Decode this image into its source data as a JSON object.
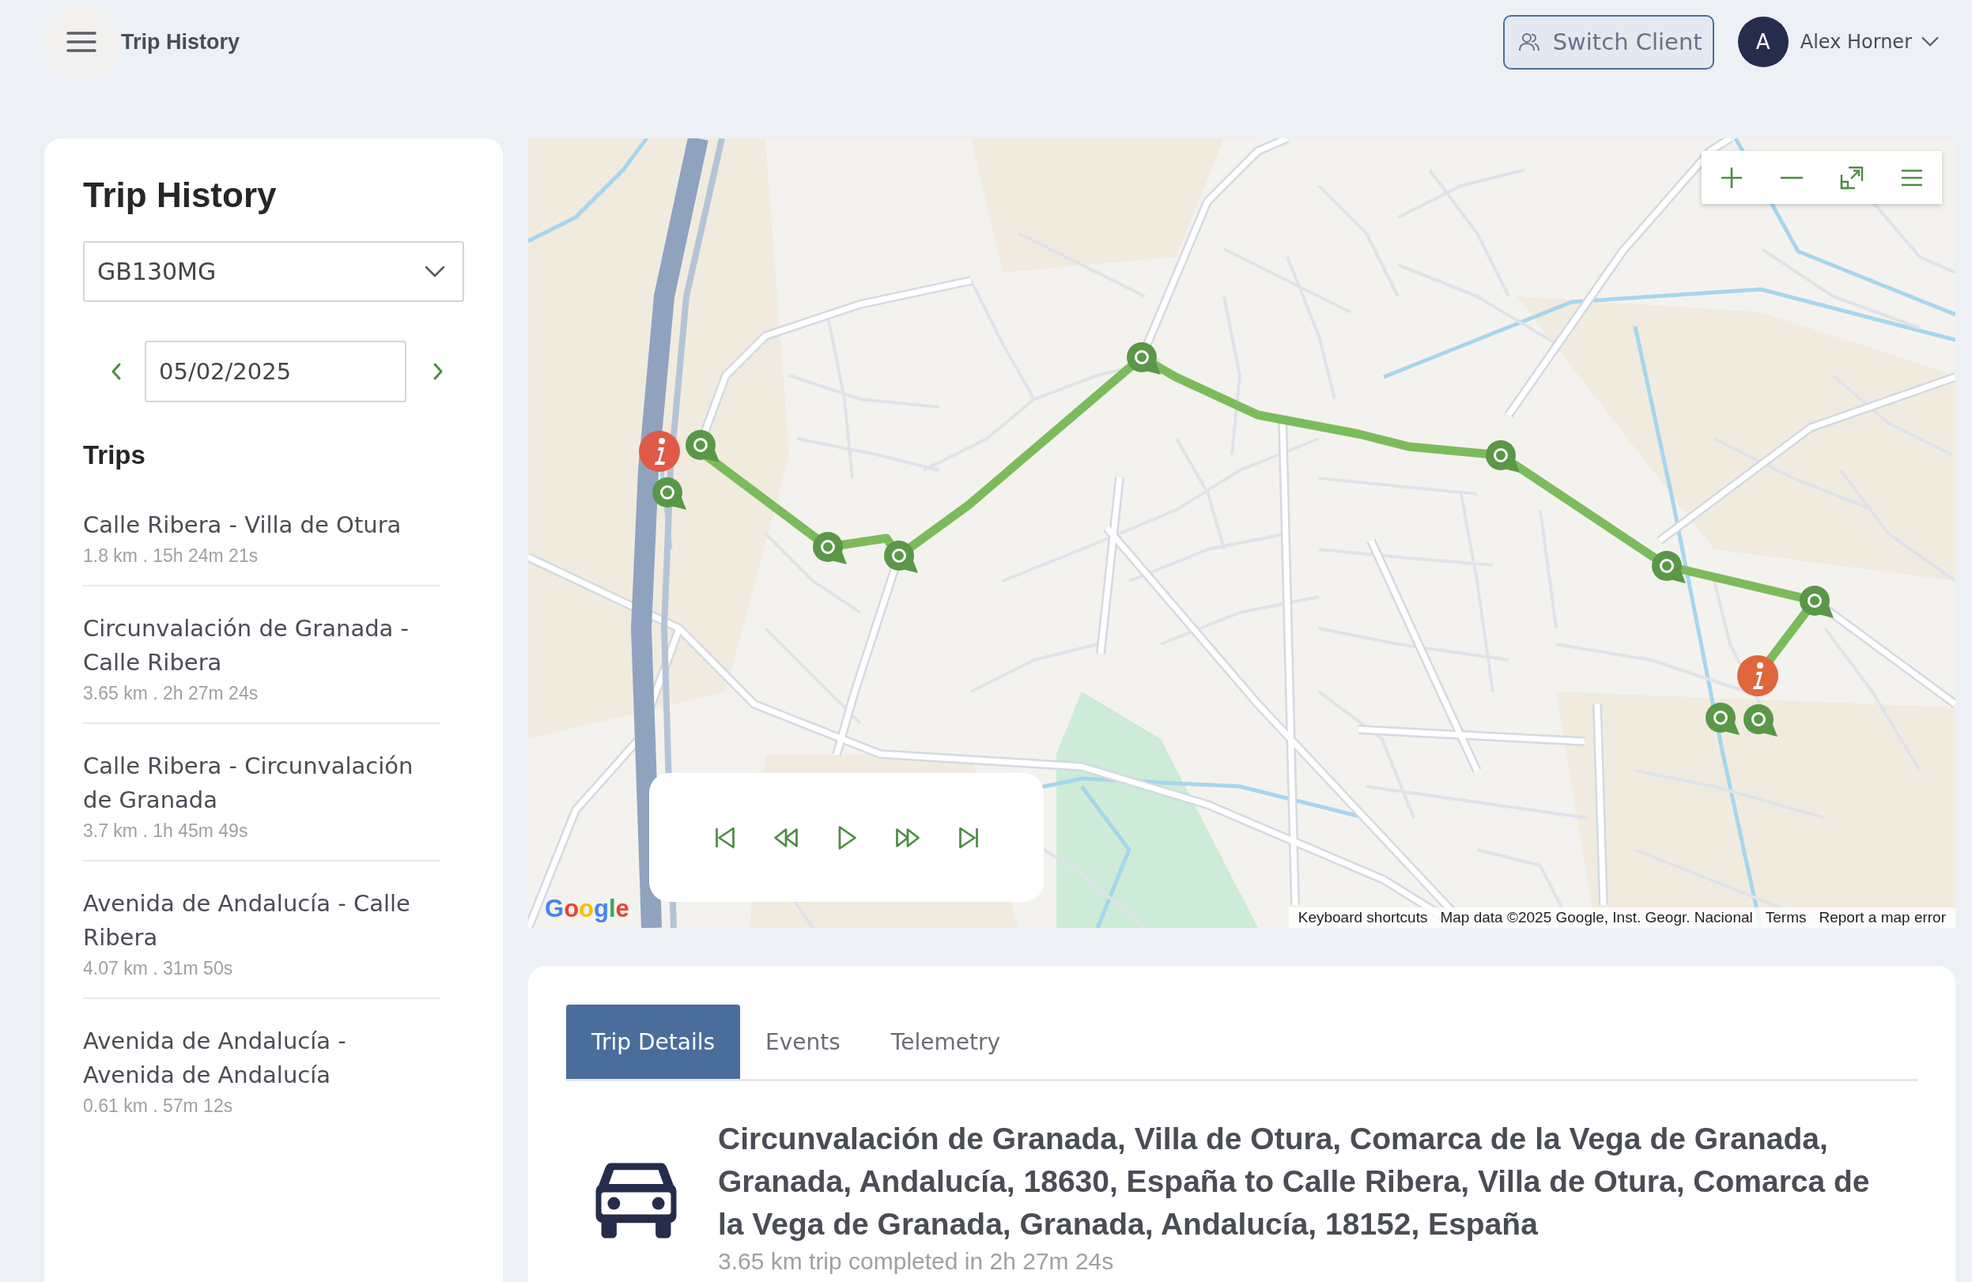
{
  "header": {
    "title": "Trip History",
    "switch_client": "Switch Client",
    "user": {
      "initial": "A",
      "name": "Alex Horner"
    }
  },
  "sidebar": {
    "title": "Trip History",
    "vehicle_select": {
      "value": "GB130MG"
    },
    "date_field": {
      "value": "05/02/2025"
    },
    "trips_heading": "Trips",
    "trips": [
      {
        "title": "Calle Ribera - Villa de Otura",
        "meta": "1.8 km . 15h 24m 21s"
      },
      {
        "title": "Circunvalación de Granada - Calle Ribera",
        "meta": "3.65 km . 2h 27m 24s"
      },
      {
        "title": "Calle Ribera - Circunvalación de Granada",
        "meta": "3.7 km . 1h 45m 49s"
      },
      {
        "title": "Avenida de Andalucía - Calle Ribera",
        "meta": "4.07 km . 31m 50s"
      },
      {
        "title": "Avenida de Andalucía - Avenida de Andalucía",
        "meta": "0.61 km . 57m 12s"
      }
    ]
  },
  "map": {
    "logo": "Google",
    "attribution": [
      "Keyboard shortcuts",
      "Map data ©2025 Google, Inst. Geogr. Nacional",
      "Terms",
      "Report a map error"
    ]
  },
  "details": {
    "tabs": [
      {
        "label": "Trip Details",
        "selected": true
      },
      {
        "label": "Events",
        "selected": false
      },
      {
        "label": "Telemetry",
        "selected": false
      }
    ],
    "address": "Circunvalación de Granada, Villa de Otura, Comarca de la Vega de Granada, Granada, Andalucía, 18630, España to Calle Ribera, Villa de Otura, Comarca de la Vega de Granada, Granada, Andalucía, 18152, España",
    "summary": "3.65 km trip completed in 2h 27m 24s"
  }
}
